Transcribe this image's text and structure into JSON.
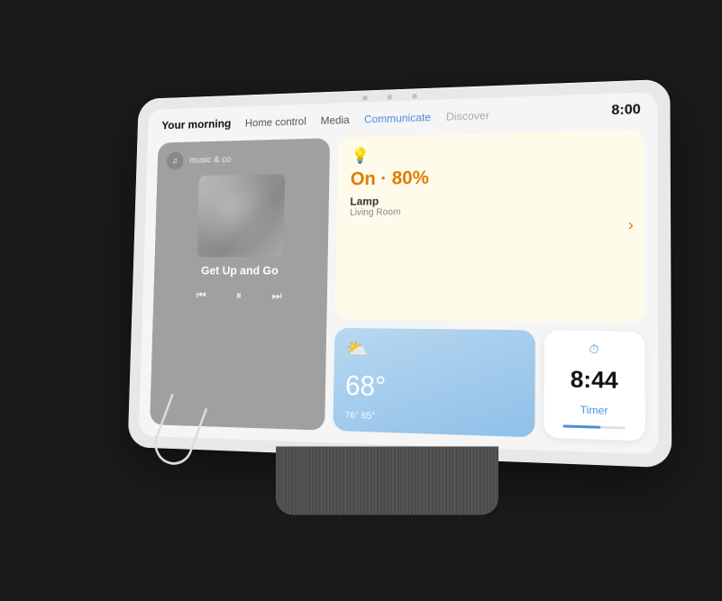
{
  "device": {
    "time": "8:00"
  },
  "nav": {
    "tabs": [
      {
        "id": "your-morning",
        "label": "Your morning",
        "state": "active"
      },
      {
        "id": "home-control",
        "label": "Home control",
        "state": "normal"
      },
      {
        "id": "media",
        "label": "Media",
        "state": "normal"
      },
      {
        "id": "communicate",
        "label": "Communicate",
        "state": "highlight"
      },
      {
        "id": "discover",
        "label": "Discover",
        "state": "faded"
      }
    ]
  },
  "music": {
    "app_name": "music & co",
    "song_title": "Get Up and Go",
    "controls": {
      "prev": "⏮",
      "play_pause": "⏸",
      "next": "⏭"
    }
  },
  "lamp": {
    "status": "On · 80%",
    "name": "Lamp",
    "location": "Living Room",
    "icon": "💡"
  },
  "weather": {
    "icon": "⛅",
    "temperature": "68°",
    "high": "76°",
    "low": "65°",
    "range_label": "76° 65°"
  },
  "timer": {
    "time": "8:44",
    "label": "Timer",
    "progress_pct": 60
  }
}
